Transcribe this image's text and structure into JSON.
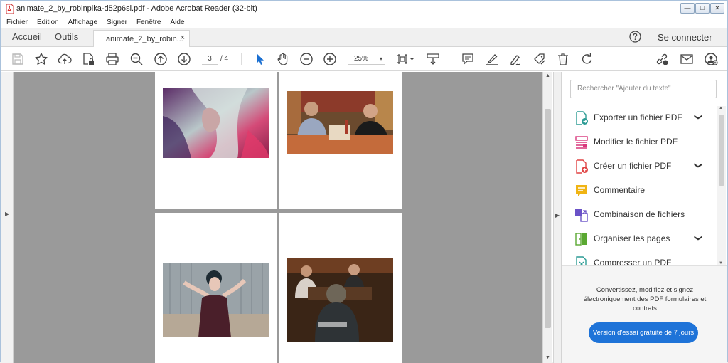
{
  "window": {
    "title": "animate_2_by_robinpika-d52p6si.pdf - Adobe Acrobat Reader (32-bit)",
    "controls": [
      "—",
      "□",
      "✕"
    ]
  },
  "menu": [
    "Fichier",
    "Edition",
    "Affichage",
    "Signer",
    "Fenêtre",
    "Aide"
  ],
  "tabs": {
    "home": "Accueil",
    "tools": "Outils",
    "document": "animate_2_by_robin...",
    "close": "×"
  },
  "header": {
    "connect": "Se connecter"
  },
  "toolbar": {
    "page_current": "3",
    "page_total": "/ 4",
    "zoom": "25%",
    "zoom_caret": "▾"
  },
  "panel": {
    "search_placeholder": "Rechercher \"Ajouter du texte\"",
    "tools": [
      {
        "label": "Exporter un fichier PDF",
        "chevron": "⌄",
        "icon": "export-pdf-icon",
        "color": "#2d9c95"
      },
      {
        "label": "Modifier le fichier PDF",
        "chevron": "",
        "icon": "edit-pdf-icon",
        "color": "#d9377c"
      },
      {
        "label": "Créer un fichier PDF",
        "chevron": "⌄",
        "icon": "create-pdf-icon",
        "color": "#e04343"
      },
      {
        "label": "Commentaire",
        "chevron": "",
        "icon": "comment-icon",
        "color": "#f0b413"
      },
      {
        "label": "Combinaison de fichiers",
        "chevron": "",
        "icon": "combine-files-icon",
        "color": "#6a52c7"
      },
      {
        "label": "Organiser les pages",
        "chevron": "⌄",
        "icon": "organize-pages-icon",
        "color": "#5aa832"
      },
      {
        "label": "Compresser un PDF",
        "chevron": "",
        "icon": "compress-pdf-icon",
        "color": "#2d9c95"
      }
    ]
  },
  "promo": {
    "text": "Convertissez, modifiez et signez électroniquement des PDF formulaires et contrats",
    "button": "Version d'essai gratuite de 7 jours"
  },
  "colors": {
    "accent_blue": "#1e73d8",
    "doc_background": "#9a9a9a",
    "pointer_blue": "#1a6fd1"
  }
}
